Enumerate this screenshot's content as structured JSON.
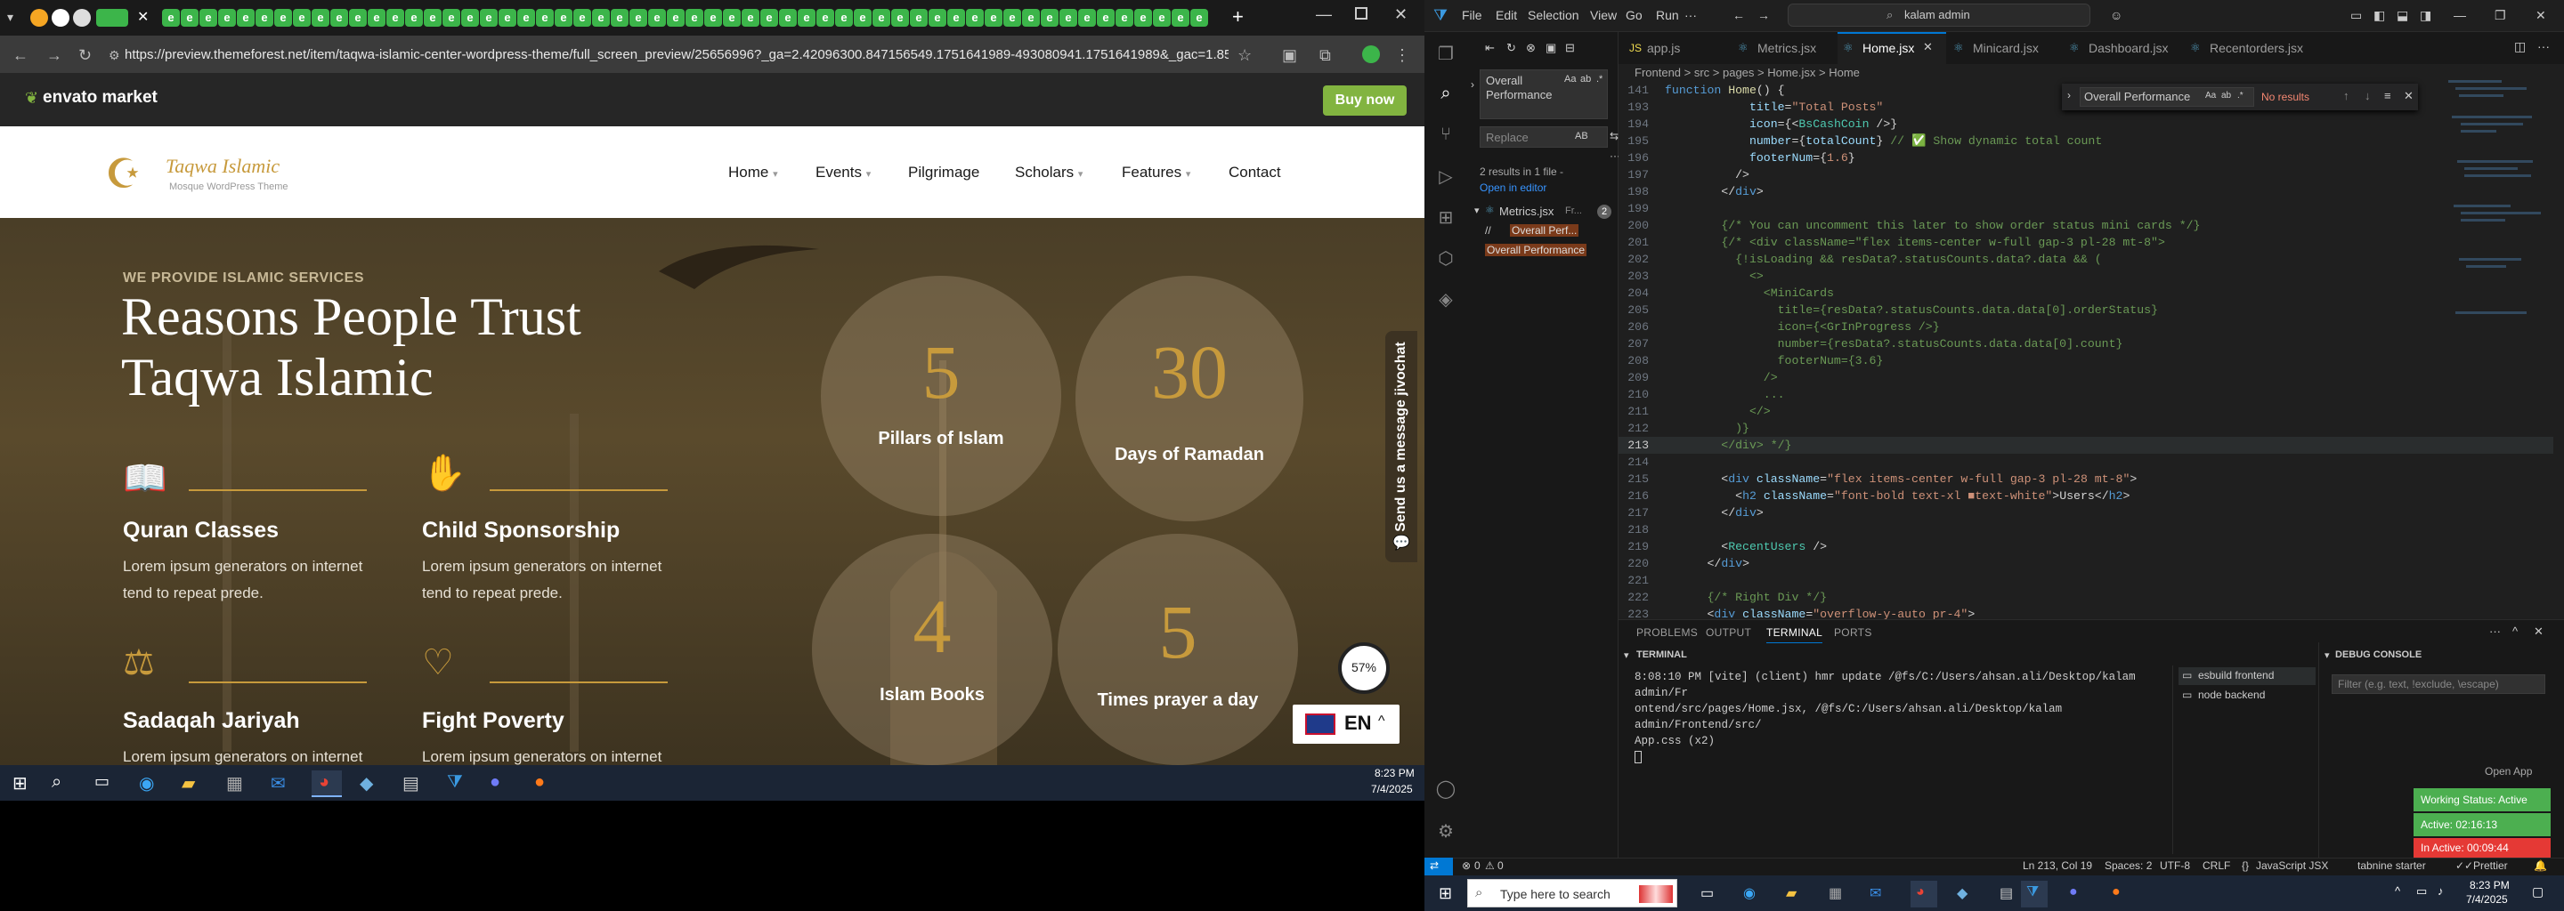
{
  "browser": {
    "url": "https://preview.themeforest.net/item/taqwa-islamic-center-wordpress-theme/full_screen_preview/25656996?_ga=2.42096300.847156549.1751641989-493080941.1751641989&_gac=1.85513707.17...",
    "envato_logo": "envato market",
    "buy_now": "Buy now"
  },
  "site": {
    "logo_title": "Taqwa Islamic",
    "logo_subtitle": "Mosque WordPress Theme",
    "nav": [
      "Home",
      "Events",
      "Pilgrimage",
      "Scholars",
      "Features",
      "Contact"
    ],
    "dropdown_flags": [
      true,
      true,
      false,
      true,
      true,
      false
    ]
  },
  "hero": {
    "eyebrow": "WE PROVIDE ISLAMIC SERVICES",
    "heading_line1": "Reasons People Trust",
    "heading_line2": "Taqwa Islamic",
    "services": [
      {
        "title": "Quran Classes",
        "text": "Lorem ipsum generators on internet tend to repeat prede."
      },
      {
        "title": "Child Sponsorship",
        "text": "Lorem ipsum generators on internet tend to repeat prede."
      },
      {
        "title": "Sadaqah Jariyah",
        "text": "Lorem ipsum generators on internet"
      },
      {
        "title": "Fight Poverty",
        "text": "Lorem ipsum generators on internet"
      }
    ],
    "stats": [
      {
        "num": "5",
        "label": "Pillars of Islam"
      },
      {
        "num": "30",
        "label": "Days of Ramadan"
      },
      {
        "num": "4",
        "label": "Islam Books"
      },
      {
        "num": "5",
        "label": "Times prayer a day"
      }
    ],
    "chat_label": "Send us a message jivochat",
    "progress": "57%",
    "lang": "EN"
  },
  "taskbar_left": {
    "time": "8:23 PM",
    "date": "7/4/2025"
  },
  "vscode": {
    "menu": [
      "File",
      "Edit",
      "Selection",
      "View",
      "Go",
      "Run"
    ],
    "search_box": "kalam admin",
    "tabs": [
      "app.js",
      "Metrics.jsx",
      "Home.jsx",
      "Minicard.jsx",
      "Dashboard.jsx",
      "Recentorders.jsx"
    ],
    "active_tab": "Home.jsx",
    "breadcrumb": "Frontend > src > pages > Home.jsx > Home",
    "search": {
      "query": "Overall Performance",
      "replace_placeholder": "Replace",
      "results_summary": "2 results in 1 file -",
      "open_in_editor": "Open in editor",
      "file": "Metrics.jsx",
      "file_path": "Fr...",
      "count": "2",
      "match1_prefix": "//",
      "match1": "Overall Perf...",
      "match2": "Overall Performance"
    },
    "find_widget": {
      "query": "Overall Performance",
      "result": "No results"
    },
    "code_lines": [
      {
        "n": "141",
        "html": "<span class='k'>function</span> <span class='f'>Home</span>() {"
      },
      {
        "n": "193",
        "html": "            <span class='a'>title</span>=<span class='s'>\"Total Posts\"</span>"
      },
      {
        "n": "194",
        "html": "            <span class='a'>icon</span>={&lt;<span class='t'>BsCashCoin</span> /&gt;}"
      },
      {
        "n": "195",
        "html": "            <span class='a'>number</span>={<span class='a'>totalCount</span>} <span class='c'>// ✅ Show dynamic total count</span>"
      },
      {
        "n": "196",
        "html": "            <span class='a'>footerNum</span>={<span class='s'>1.6</span>}"
      },
      {
        "n": "197",
        "html": "          /&gt;"
      },
      {
        "n": "198",
        "html": "        &lt;/<span class='k'>div</span>&gt;"
      },
      {
        "n": "199",
        "html": ""
      },
      {
        "n": "200",
        "html": "        <span class='c'>{/* You can uncomment this later to show order status mini cards */}</span>"
      },
      {
        "n": "201",
        "html": "        <span class='c'>{/* &lt;div className=\"flex items-center w-full gap-3 pl-28 mt-8\"&gt;</span>"
      },
      {
        "n": "202",
        "html": "<span class='c'>          {!isLoading &amp;&amp; resData?.statusCounts.data?.data &amp;&amp; (</span>"
      },
      {
        "n": "203",
        "html": "<span class='c'>            &lt;&gt;</span>"
      },
      {
        "n": "204",
        "html": "<span class='c'>              &lt;MiniCards</span>"
      },
      {
        "n": "205",
        "html": "<span class='c'>                title={resData?.statusCounts.data.data[0].orderStatus}</span>"
      },
      {
        "n": "206",
        "html": "<span class='c'>                icon={&lt;GrInProgress /&gt;}</span>"
      },
      {
        "n": "207",
        "html": "<span class='c'>                number={resData?.statusCounts.data.data[0].count}</span>"
      },
      {
        "n": "208",
        "html": "<span class='c'>                footerNum={3.6}</span>"
      },
      {
        "n": "209",
        "html": "<span class='c'>              /&gt;</span>"
      },
      {
        "n": "210",
        "html": "<span class='c'>              ...</span>"
      },
      {
        "n": "211",
        "html": "<span class='c'>            &lt;/&gt;</span>"
      },
      {
        "n": "212",
        "html": "<span class='c'>          )}</span>"
      },
      {
        "n": "213",
        "html": "<span class='c'>        &lt;/div&gt; */}</span>"
      },
      {
        "n": "214",
        "html": ""
      },
      {
        "n": "215",
        "html": "        &lt;<span class='k'>div</span> <span class='a'>className</span>=<span class='s'>\"flex items-center w-full gap-3 pl-28 mt-8\"</span>&gt;"
      },
      {
        "n": "216",
        "html": "          &lt;<span class='k'>h2</span> <span class='a'>className</span>=<span class='s'>\"font-bold text-xl ■text-white\"</span>&gt;Users&lt;/<span class='k'>h2</span>&gt;"
      },
      {
        "n": "217",
        "html": "        &lt;/<span class='k'>div</span>&gt;"
      },
      {
        "n": "218",
        "html": ""
      },
      {
        "n": "219",
        "html": "        &lt;<span class='t'>RecentUsers</span> /&gt;"
      },
      {
        "n": "220",
        "html": "      &lt;/<span class='k'>div</span>&gt;"
      },
      {
        "n": "221",
        "html": ""
      },
      {
        "n": "222",
        "html": "      <span class='c'>{/* Right Div */}</span>"
      },
      {
        "n": "223",
        "html": "      &lt;<span class='k'>div</span> <span class='a'>className</span>=<span class='s'>\"overflow-y-auto pr-4\"</span>&gt;"
      }
    ],
    "panel_tabs": [
      "PROBLEMS",
      "OUTPUT",
      "TERMINAL",
      "PORTS"
    ],
    "terminal_title": "TERMINAL",
    "terminal_line1": "8:08:10 PM [vite] (client) hmr update /@fs/C:/Users/ahsan.ali/Desktop/kalam admin/Fr",
    "terminal_line2": "ontend/src/pages/Home.jsx, /@fs/C:/Users/ahsan.ali/Desktop/kalam admin/Frontend/src/",
    "terminal_line3": "App.css (x2)",
    "terminals": [
      "esbuild frontend",
      "node backend"
    ],
    "debug_title": "DEBUG CONSOLE",
    "debug_filter_placeholder": "Filter (e.g. text, !exclude, \\escape)",
    "tracker": {
      "open": "Open App",
      "status": "Working Status: Active",
      "active": "Active: 02:16:13",
      "inactive": "In Active: 00:09:44"
    },
    "status": {
      "errors": "0",
      "warnings": "0",
      "position": "Ln 213, Col 19",
      "spaces": "Spaces: 2",
      "encoding": "UTF-8",
      "eol": "CRLF",
      "lang": "JavaScript JSX",
      "tabnine": "tabnine starter",
      "prettier": "Prettier"
    }
  },
  "taskbar_right": {
    "search": "Type here to search",
    "time": "8:23 PM",
    "date": "7/4/2025"
  }
}
